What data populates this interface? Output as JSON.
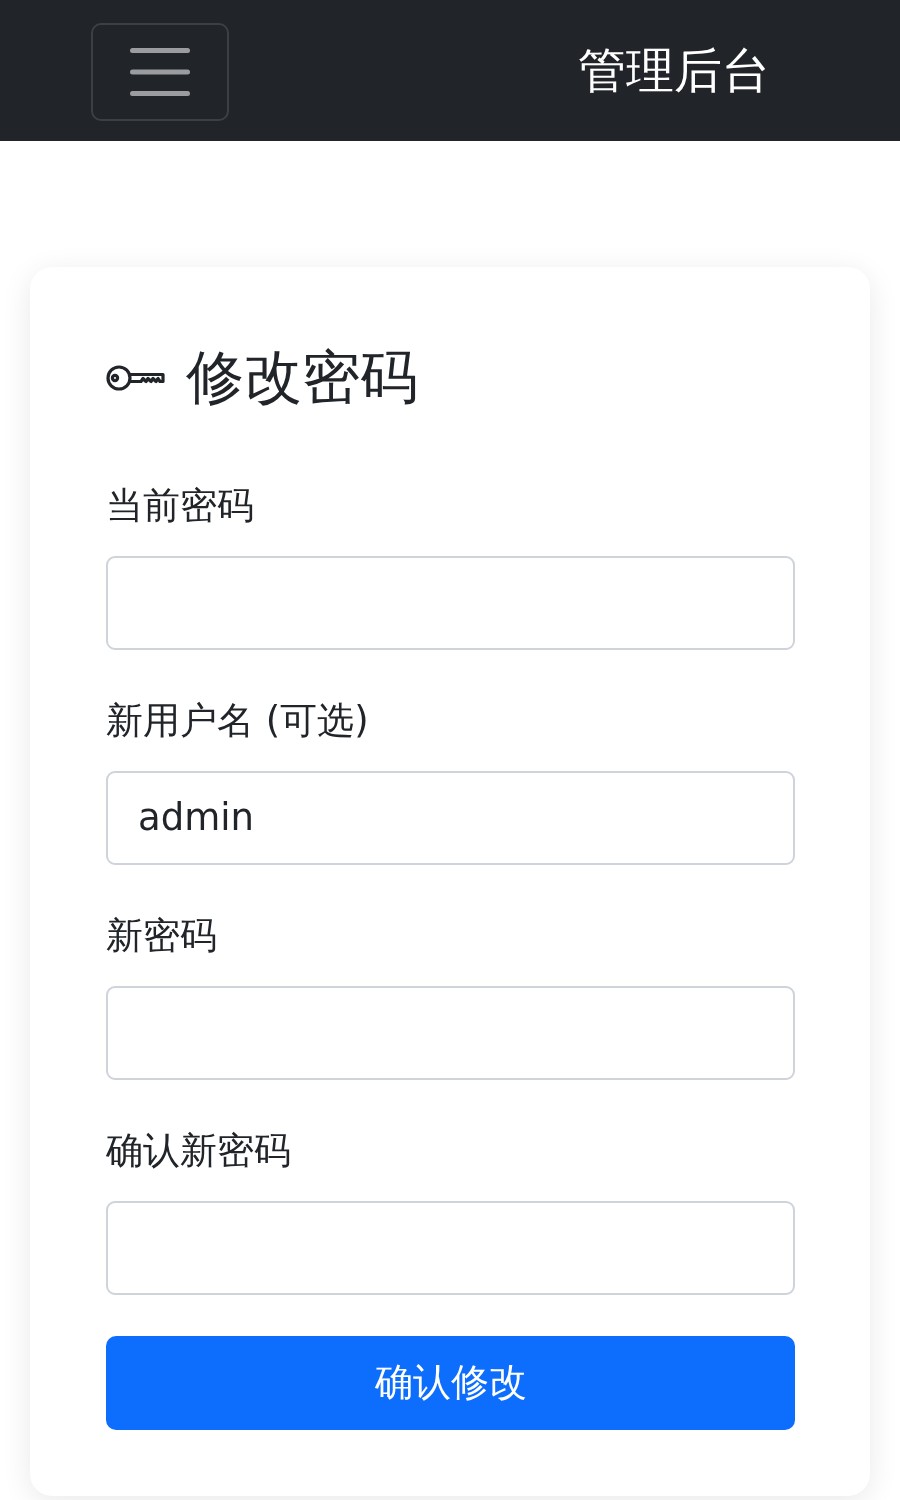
{
  "navbar": {
    "brand": "管理后台"
  },
  "form": {
    "title": "修改密码",
    "fields": [
      {
        "label": "当前密码"
      },
      {
        "label": "新用户名 (可选)",
        "value": "admin"
      },
      {
        "label": "新密码"
      },
      {
        "label": "确认新密码"
      }
    ],
    "submit_button": "确认修改"
  }
}
